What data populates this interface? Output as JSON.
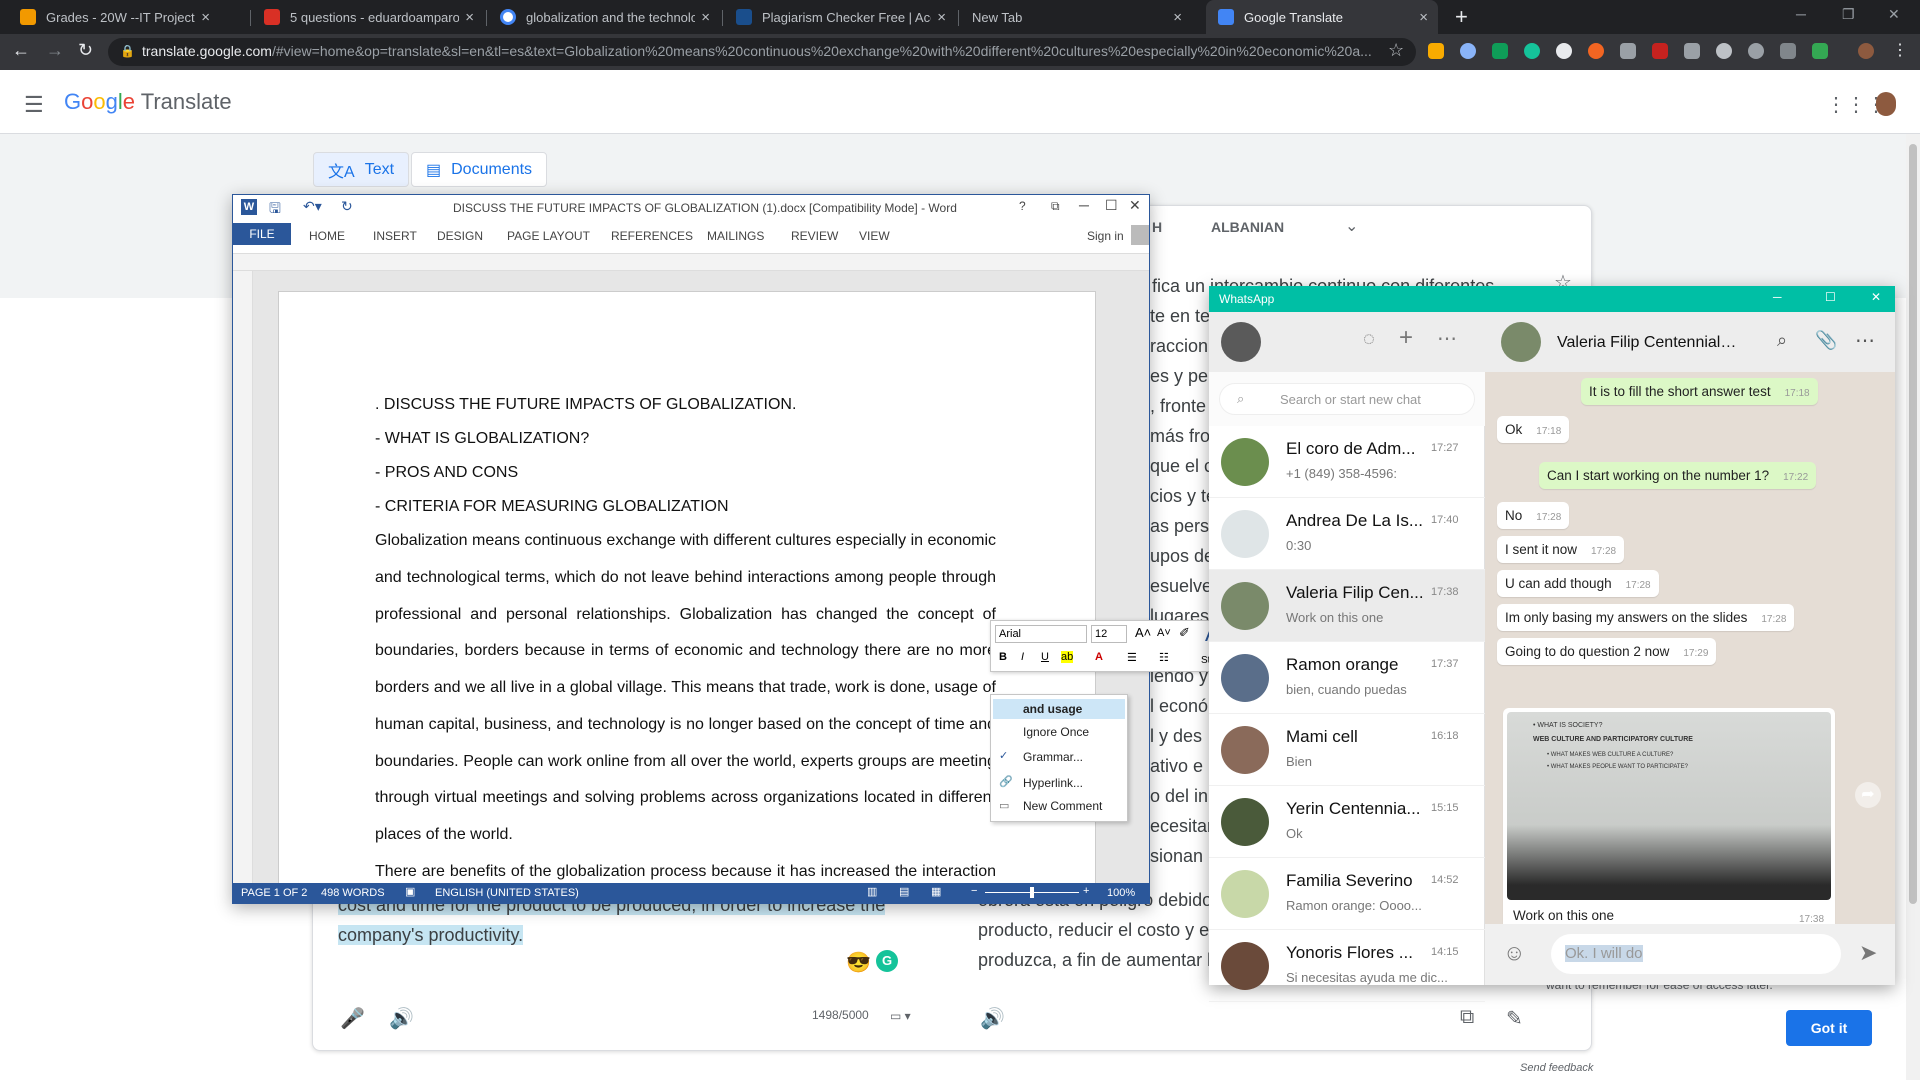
{
  "browser": {
    "tabs": [
      {
        "title": "Grades - 20W --IT Project Manag",
        "color": "#f29900"
      },
      {
        "title": "5 questions - eduardoamparos@",
        "color": "#d93025"
      },
      {
        "title": "globalization and the technology",
        "color": "#4285f4"
      },
      {
        "title": "Plagiarism Checker Free | Accura",
        "color": "#1a4e8c"
      },
      {
        "title": "New Tab",
        "color": ""
      },
      {
        "title": "Google Translate",
        "color": "#4285f4"
      }
    ],
    "url_host": "translate.google.com",
    "url_rest": "/#view=home&op=translate&sl=en&tl=es&text=Globalization%20means%20continuous%20exchange%20with%20different%20cultures%20especially%20in%20economic%20a..."
  },
  "translate": {
    "app_name": "Translate",
    "modes": {
      "text": "Text",
      "documents": "Documents"
    },
    "target_lang": "ALBANIAN",
    "target_lang_partial": "H",
    "translated_fragments": [
      "fica un intercambio continuo con diferentes",
      "te en te",
      "raccion",
      "es y pe",
      ", fronte",
      "más fron",
      "que el c",
      "cios y te",
      "as perso",
      "upos de",
      "esuelve",
      " lugares",
      "",
      "iendo y",
      "l econó",
      "l y des",
      "ativo e",
      "o del in",
      "ecesitar",
      "sionan",
      "obrera está en peligro debido",
      "producto, reducir el costo y e",
      "produzca, a fin de aumentar l"
    ],
    "source_highlight_1": "cost and time for the product to be produced, in order to increase the",
    "source_highlight_2": "company's productivity.",
    "char_count": "1498/5000",
    "popup_text": "want to remember for ease of access later.",
    "got_it": "Got it",
    "send_feedback": "Send feedback"
  },
  "word": {
    "title": "DISCUSS THE FUTURE IMPACTS OF GLOBALIZATION (1).docx [Compatibility Mode] - Word",
    "ribbon_tabs": [
      "FILE",
      "HOME",
      "INSERT",
      "DESIGN",
      "PAGE LAYOUT",
      "REFERENCES",
      "MAILINGS",
      "REVIEW",
      "VIEW"
    ],
    "sign_in": "Sign in",
    "lines": [
      ". DISCUSS THE FUTURE IMPACTS OF GLOBALIZATION.",
      "- WHAT IS GLOBALIZATION?",
      "- PROS AND CONS",
      "- CRITERIA FOR MEASURING GLOBALIZATION"
    ],
    "paragraph": [
      "Globalization means continuous exchange with different cultures especially in economic",
      "and technological terms, which do not leave behind interactions among people through",
      "professional and personal relationships. Globalization has changed the concept of",
      "boundaries, borders because in terms of economic and technology there are no more",
      "borders and we all live in a global village. This means that trade, work is done, usage of",
      "human capital, business, and technology is no longer based on the concept of time and",
      "boundaries. People can work online from all over the world, experts groups are meeting",
      "through virtual meetings and solving problems across organizations located in different",
      "places of the world.",
      "There are benefits of the globalization process because it has increased the interaction"
    ],
    "status": {
      "page": "PAGE 1 OF 2",
      "words": "498 WORDS",
      "language": "ENGLISH (UNITED STATES)",
      "zoom": "100%"
    },
    "mini_toolbar": {
      "font": "Arial",
      "size": "12",
      "styles": "Styles"
    },
    "context_menu": [
      "and usage",
      "Ignore Once",
      "Grammar...",
      "Hyperlink...",
      "New Comment"
    ]
  },
  "whatsapp": {
    "title": "WhatsApp",
    "search_placeholder": "Search or start new chat",
    "chats": [
      {
        "name": "El coro de Adm...",
        "time": "17:27",
        "preview": "+1 (849) 358-4596: ",
        "avatar": "#6b8e4e"
      },
      {
        "name": "Andrea De La Is...",
        "time": "17:40",
        "preview": "0:30",
        "avatar": "#dfe5e7"
      },
      {
        "name": "Valeria Filip Cen...",
        "time": "17:38",
        "preview": "Work on this one",
        "avatar": "#7a8a6a"
      },
      {
        "name": "Ramon orange",
        "time": "17:37",
        "preview": "bien, cuando puedas",
        "avatar": "#5a6e8a"
      },
      {
        "name": "Mami cell",
        "time": "16:18",
        "preview": "Bien",
        "avatar": "#8a6a5a"
      },
      {
        "name": "Yerin Centennia...",
        "time": "15:15",
        "preview": "Ok",
        "avatar": "#4a5a3a"
      },
      {
        "name": "Familia Severino",
        "time": "14:52",
        "preview": "Ramon orange: Oooo...",
        "avatar": "#c8d8a8"
      },
      {
        "name": "Yonoris Flores ...",
        "time": "14:15",
        "preview": "Si necesitas ayuda me dic...",
        "avatar": "#6a4a3a"
      }
    ],
    "chat_name": "Valeria Filip Centennial R...",
    "messages": [
      {
        "text": "It is to fill the short answer test",
        "time": "17:18",
        "dir": "out"
      },
      {
        "text": "Ok",
        "time": "17:18",
        "dir": "in"
      },
      {
        "text": "Can I start working on the number 1?",
        "time": "17:22",
        "dir": "out"
      },
      {
        "text": "No",
        "time": "17:28",
        "dir": "in"
      },
      {
        "text": "I sent it now",
        "time": "17:28",
        "dir": "in"
      },
      {
        "text": "U can add though",
        "time": "17:28",
        "dir": "in"
      },
      {
        "text": "Im only basing my answers on the slides",
        "time": "17:28",
        "dir": "in"
      },
      {
        "text": "Going to do question 2 now",
        "time": "17:29",
        "dir": "in"
      }
    ],
    "image_caption": "Work on this one",
    "image_time": "17:38",
    "image_lines": [
      "• WHAT IS SOCIETY?",
      "WEB CULTURE AND PARTICIPATORY CULTURE",
      "• WHAT MAKES WEB CULTURE A CULTURE?",
      "• WHAT MAKES PEOPLE WANT TO PARTICIPATE?"
    ],
    "input_text": "Ok. I will do"
  }
}
